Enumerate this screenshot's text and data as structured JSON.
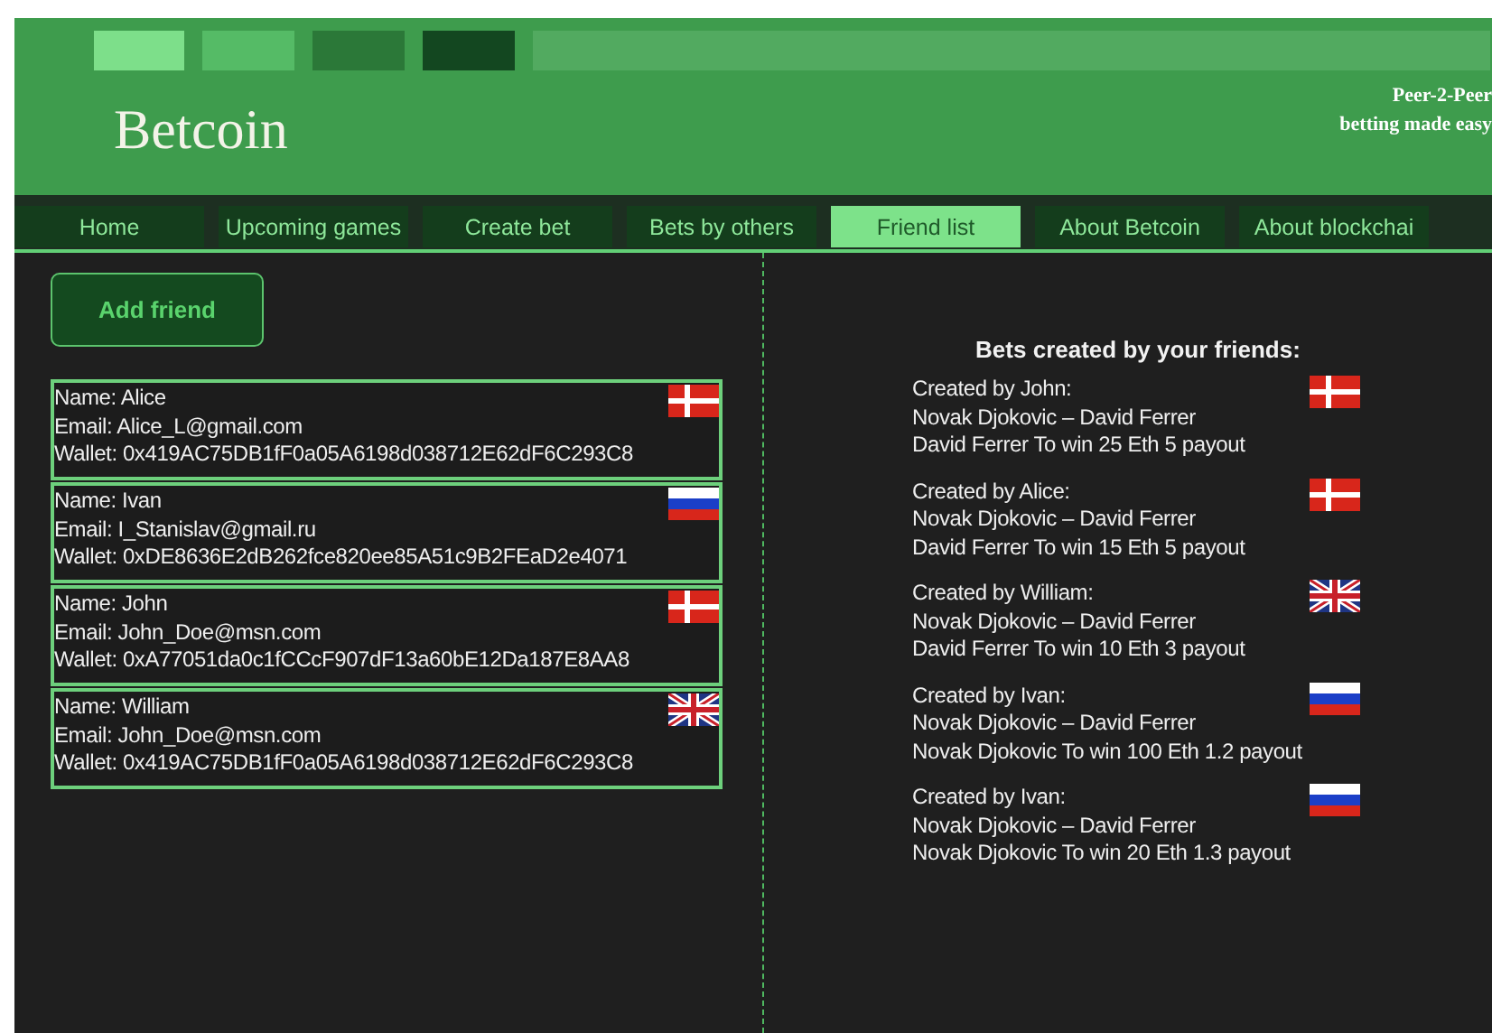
{
  "header": {
    "logo": "Betcoin",
    "tagline": [
      "Peer-2-Peer",
      "betting made easy"
    ]
  },
  "nav": [
    {
      "label": "Home",
      "selected": false
    },
    {
      "label": "Upcoming games",
      "selected": false
    },
    {
      "label": "Create bet",
      "selected": false
    },
    {
      "label": "Bets by others",
      "selected": false
    },
    {
      "label": "Friend list",
      "selected": true
    },
    {
      "label": "About Betcoin",
      "selected": false
    },
    {
      "label": "About blockchai",
      "selected": false
    }
  ],
  "add_friend_button": "Add friend",
  "friends": [
    {
      "name": "Name: Alice",
      "email": "Email: Alice_L@gmail.com",
      "wallet": "Wallet: 0x419AC75DB1fF0a05A6198d038712E62dF6C293C8",
      "flag": {
        "kind": "dk"
      }
    },
    {
      "name": "Name: Ivan",
      "email": "Email: I_Stanislav@gmail.ru",
      "wallet": "Wallet: 0xDE8636E2dB262fce820ee85A51c9B2FEaD2e4071",
      "flag": {
        "kind": "ru"
      }
    },
    {
      "name": "Name: John",
      "email": "Email: John_Doe@msn.com",
      "wallet": "Wallet: 0xA77051da0c1fCCcF907dF13a60bE12Da187E8AA8",
      "flag": {
        "kind": "dk"
      }
    },
    {
      "name": "Name: William",
      "email": "Email: John_Doe@msn.com",
      "wallet": "Wallet: 0x419AC75DB1fF0a05A6198d038712E62dF6C293C8",
      "flag": {
        "kind": "gb"
      }
    }
  ],
  "bets_title": "Bets created by your friends:",
  "bets": [
    {
      "creator": "Created by John:",
      "match": "Novak Djokovic – David Ferrer",
      "terms": "David Ferrer To win 25 Eth 5 payout",
      "flag": {
        "kind": "dk"
      }
    },
    {
      "creator": "Created by Alice:",
      "match": "Novak Djokovic – David Ferrer",
      "terms": "David Ferrer To win 15 Eth 5 payout",
      "flag": {
        "kind": "dk"
      }
    },
    {
      "creator": "Created by William:",
      "match": "Novak Djokovic – David Ferrer",
      "terms": "David Ferrer To win 10 Eth 3 payout",
      "flag": {
        "kind": "gb"
      }
    },
    {
      "creator": "Created by Ivan:",
      "match": "Novak Djokovic – David Ferrer",
      "terms": "Novak Djokovic To win 100 Eth 1.2 payout",
      "flag": {
        "kind": "ru"
      }
    },
    {
      "creator": "Created by Ivan:",
      "match": "Novak Djokovic – David Ferrer",
      "terms": "Novak Djokovic To win 20 Eth 1.3 payout",
      "flag": {
        "kind": "ru"
      }
    }
  ]
}
